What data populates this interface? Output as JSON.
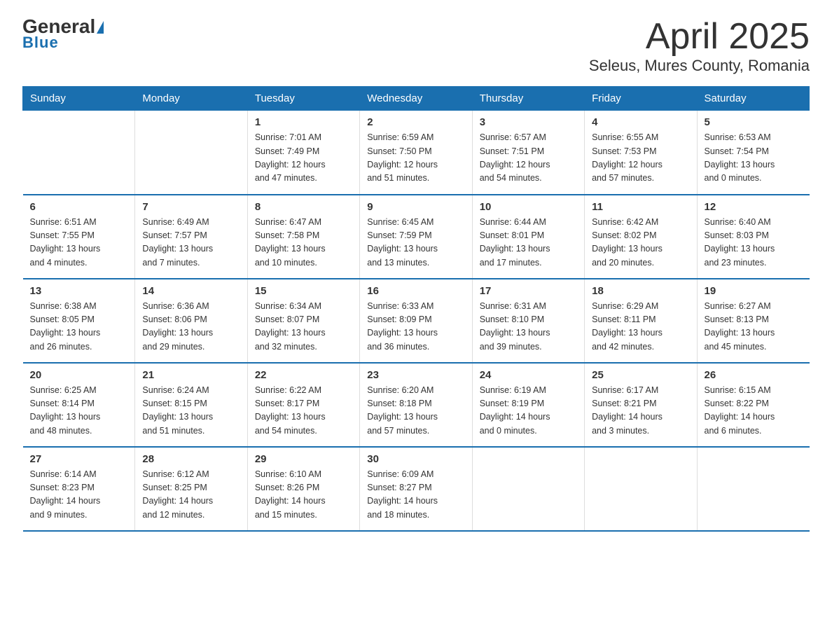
{
  "logo": {
    "text_general": "General",
    "text_blue": "Blue"
  },
  "title": "April 2025",
  "subtitle": "Seleus, Mures County, Romania",
  "days_of_week": [
    "Sunday",
    "Monday",
    "Tuesday",
    "Wednesday",
    "Thursday",
    "Friday",
    "Saturday"
  ],
  "weeks": [
    [
      {
        "day": "",
        "info": ""
      },
      {
        "day": "",
        "info": ""
      },
      {
        "day": "1",
        "info": "Sunrise: 7:01 AM\nSunset: 7:49 PM\nDaylight: 12 hours\nand 47 minutes."
      },
      {
        "day": "2",
        "info": "Sunrise: 6:59 AM\nSunset: 7:50 PM\nDaylight: 12 hours\nand 51 minutes."
      },
      {
        "day": "3",
        "info": "Sunrise: 6:57 AM\nSunset: 7:51 PM\nDaylight: 12 hours\nand 54 minutes."
      },
      {
        "day": "4",
        "info": "Sunrise: 6:55 AM\nSunset: 7:53 PM\nDaylight: 12 hours\nand 57 minutes."
      },
      {
        "day": "5",
        "info": "Sunrise: 6:53 AM\nSunset: 7:54 PM\nDaylight: 13 hours\nand 0 minutes."
      }
    ],
    [
      {
        "day": "6",
        "info": "Sunrise: 6:51 AM\nSunset: 7:55 PM\nDaylight: 13 hours\nand 4 minutes."
      },
      {
        "day": "7",
        "info": "Sunrise: 6:49 AM\nSunset: 7:57 PM\nDaylight: 13 hours\nand 7 minutes."
      },
      {
        "day": "8",
        "info": "Sunrise: 6:47 AM\nSunset: 7:58 PM\nDaylight: 13 hours\nand 10 minutes."
      },
      {
        "day": "9",
        "info": "Sunrise: 6:45 AM\nSunset: 7:59 PM\nDaylight: 13 hours\nand 13 minutes."
      },
      {
        "day": "10",
        "info": "Sunrise: 6:44 AM\nSunset: 8:01 PM\nDaylight: 13 hours\nand 17 minutes."
      },
      {
        "day": "11",
        "info": "Sunrise: 6:42 AM\nSunset: 8:02 PM\nDaylight: 13 hours\nand 20 minutes."
      },
      {
        "day": "12",
        "info": "Sunrise: 6:40 AM\nSunset: 8:03 PM\nDaylight: 13 hours\nand 23 minutes."
      }
    ],
    [
      {
        "day": "13",
        "info": "Sunrise: 6:38 AM\nSunset: 8:05 PM\nDaylight: 13 hours\nand 26 minutes."
      },
      {
        "day": "14",
        "info": "Sunrise: 6:36 AM\nSunset: 8:06 PM\nDaylight: 13 hours\nand 29 minutes."
      },
      {
        "day": "15",
        "info": "Sunrise: 6:34 AM\nSunset: 8:07 PM\nDaylight: 13 hours\nand 32 minutes."
      },
      {
        "day": "16",
        "info": "Sunrise: 6:33 AM\nSunset: 8:09 PM\nDaylight: 13 hours\nand 36 minutes."
      },
      {
        "day": "17",
        "info": "Sunrise: 6:31 AM\nSunset: 8:10 PM\nDaylight: 13 hours\nand 39 minutes."
      },
      {
        "day": "18",
        "info": "Sunrise: 6:29 AM\nSunset: 8:11 PM\nDaylight: 13 hours\nand 42 minutes."
      },
      {
        "day": "19",
        "info": "Sunrise: 6:27 AM\nSunset: 8:13 PM\nDaylight: 13 hours\nand 45 minutes."
      }
    ],
    [
      {
        "day": "20",
        "info": "Sunrise: 6:25 AM\nSunset: 8:14 PM\nDaylight: 13 hours\nand 48 minutes."
      },
      {
        "day": "21",
        "info": "Sunrise: 6:24 AM\nSunset: 8:15 PM\nDaylight: 13 hours\nand 51 minutes."
      },
      {
        "day": "22",
        "info": "Sunrise: 6:22 AM\nSunset: 8:17 PM\nDaylight: 13 hours\nand 54 minutes."
      },
      {
        "day": "23",
        "info": "Sunrise: 6:20 AM\nSunset: 8:18 PM\nDaylight: 13 hours\nand 57 minutes."
      },
      {
        "day": "24",
        "info": "Sunrise: 6:19 AM\nSunset: 8:19 PM\nDaylight: 14 hours\nand 0 minutes."
      },
      {
        "day": "25",
        "info": "Sunrise: 6:17 AM\nSunset: 8:21 PM\nDaylight: 14 hours\nand 3 minutes."
      },
      {
        "day": "26",
        "info": "Sunrise: 6:15 AM\nSunset: 8:22 PM\nDaylight: 14 hours\nand 6 minutes."
      }
    ],
    [
      {
        "day": "27",
        "info": "Sunrise: 6:14 AM\nSunset: 8:23 PM\nDaylight: 14 hours\nand 9 minutes."
      },
      {
        "day": "28",
        "info": "Sunrise: 6:12 AM\nSunset: 8:25 PM\nDaylight: 14 hours\nand 12 minutes."
      },
      {
        "day": "29",
        "info": "Sunrise: 6:10 AM\nSunset: 8:26 PM\nDaylight: 14 hours\nand 15 minutes."
      },
      {
        "day": "30",
        "info": "Sunrise: 6:09 AM\nSunset: 8:27 PM\nDaylight: 14 hours\nand 18 minutes."
      },
      {
        "day": "",
        "info": ""
      },
      {
        "day": "",
        "info": ""
      },
      {
        "day": "",
        "info": ""
      }
    ]
  ]
}
